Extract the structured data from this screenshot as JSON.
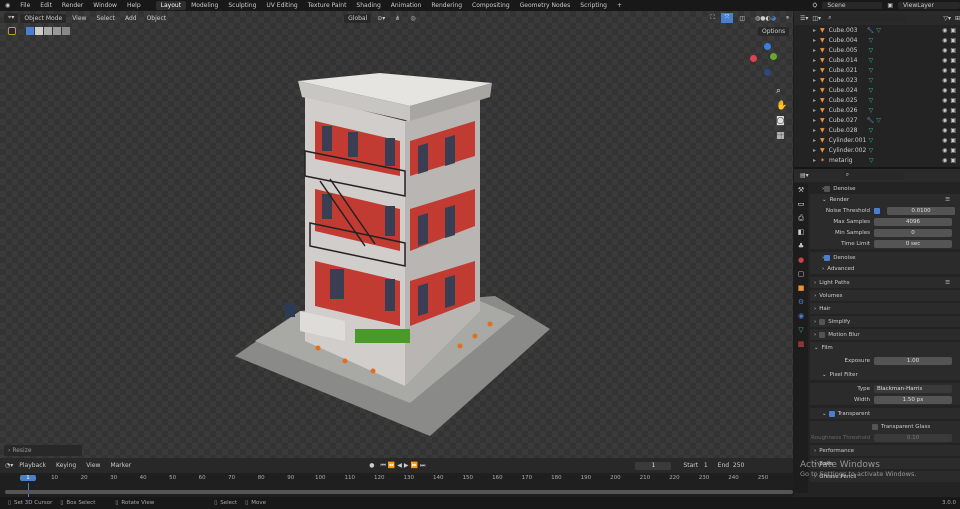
{
  "menu": [
    "File",
    "Edit",
    "Render",
    "Window",
    "Help"
  ],
  "workspaces": [
    "Layout",
    "Modeling",
    "Sculpting",
    "UV Editing",
    "Texture Paint",
    "Shading",
    "Animation",
    "Rendering",
    "Compositing",
    "Geometry Nodes",
    "Scripting",
    "+"
  ],
  "scene": "Scene",
  "view_layer": "ViewLayer",
  "viewport_header": {
    "mode": "Object Mode",
    "menus": [
      "View",
      "Select",
      "Add",
      "Object"
    ],
    "orientation": "Global",
    "options": "Options"
  },
  "outliner": {
    "items": [
      {
        "name": "Cube.003",
        "mod": true
      },
      {
        "name": "Cube.004"
      },
      {
        "name": "Cube.005"
      },
      {
        "name": "Cube.014"
      },
      {
        "name": "Cube.021"
      },
      {
        "name": "Cube.023"
      },
      {
        "name": "Cube.024"
      },
      {
        "name": "Cube.025"
      },
      {
        "name": "Cube.026"
      },
      {
        "name": "Cube.027",
        "mod": true
      },
      {
        "name": "Cube.028"
      },
      {
        "name": "Cylinder.001"
      },
      {
        "name": "Cylinder.002"
      },
      {
        "name": "metarig"
      }
    ]
  },
  "properties": {
    "denoise_top": "Denoise",
    "render": "Render",
    "noise_threshold": {
      "label": "Noise Threshold",
      "value": "0.0100"
    },
    "max_samples": {
      "label": "Max Samples",
      "value": "4096"
    },
    "min_samples": {
      "label": "Min Samples",
      "value": "0"
    },
    "time_limit": {
      "label": "Time Limit",
      "value": "0 sec"
    },
    "denoise": "Denoise",
    "advanced": "Advanced",
    "panels": [
      "Light Paths",
      "Volumes",
      "Hair",
      "Simplify",
      "Motion Blur"
    ],
    "film": "Film",
    "exposure": {
      "label": "Exposure",
      "value": "1.00"
    },
    "pixel_filter": "Pixel Filter",
    "type": {
      "label": "Type",
      "value": "Blackman-Harris"
    },
    "width": {
      "label": "Width",
      "value": "1.50 px"
    },
    "transparent": "Transparent",
    "transparent_glass": "Transparent Glass",
    "roughness": {
      "label": "Roughness Threshold",
      "value": "0.10"
    },
    "performance": "Performance",
    "bake": "Bake",
    "grease_pencil": "Grease Pencil"
  },
  "watermark": {
    "title": "Activate Windows",
    "sub": "Go to Settings to activate Windows."
  },
  "resize": "Resize",
  "timeline": {
    "menus": [
      "Playback",
      "Keying",
      "View",
      "Marker"
    ],
    "current_frame": "1",
    "start_label": "Start",
    "start": "1",
    "end_label": "End",
    "end": "250",
    "ticks": [
      "1",
      "10",
      "20",
      "30",
      "40",
      "50",
      "60",
      "70",
      "80",
      "90",
      "100",
      "110",
      "120",
      "130",
      "140",
      "150",
      "160",
      "170",
      "180",
      "190",
      "200",
      "210",
      "220",
      "230",
      "240",
      "250"
    ]
  },
  "status": {
    "items": [
      "Set 3D Cursor",
      "Box Select",
      "Rotate View",
      "Select",
      "Move"
    ],
    "version": "3.0.0"
  },
  "colors": {
    "accent": "#4a7fd0",
    "object": "#e8923a",
    "mesh": "#3fb39a"
  }
}
